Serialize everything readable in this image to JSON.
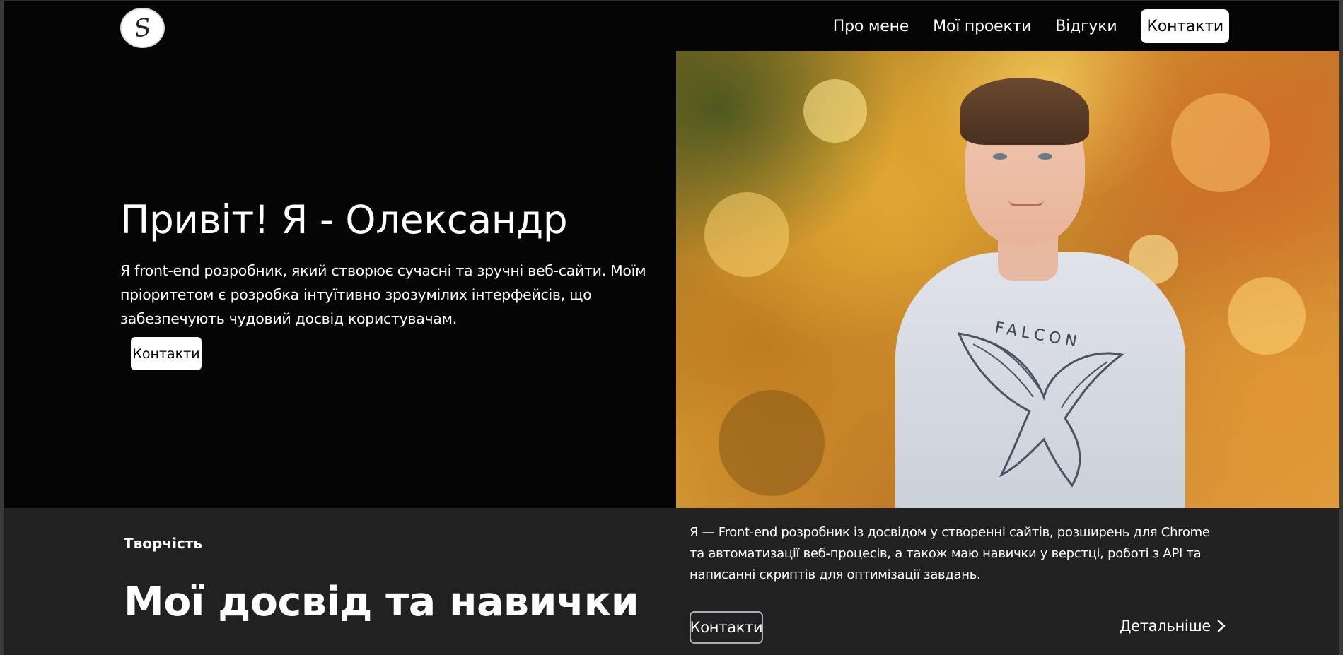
{
  "header": {
    "logo_icon": "signature-s-logo-icon",
    "logo_glyph": "S",
    "nav": [
      {
        "label": "Про мене"
      },
      {
        "label": "Мої проекти"
      },
      {
        "label": "Відгуки"
      },
      {
        "label": "Контакти"
      }
    ]
  },
  "hero": {
    "title": "Привіт! Я - Олександр",
    "text": "Я front-end розробник, який створює сучасні та зручні веб-сайти. Моїм пріоритетом є розробка інтуїтивно зрозумілих інтерфейсів, що забезпечують чудовий досвід користувачам.",
    "button_label": "Контакти",
    "photo_shirt_text": "FALCON"
  },
  "skills": {
    "eyebrow": "Творчість",
    "title": "Мої досвід та навички",
    "text": "Я — Front-end розробник із досвідом у створенні сайтів, розширень для Chrome та автоматизації веб-процесів, а також маю навички у верстці, роботі з API та написанні скриптів для оптимізації завдань.",
    "button_label": "Контакти",
    "more_label": "Детальніше",
    "more_icon": "chevron-right-icon"
  },
  "colors": {
    "hero_bg": "#050505",
    "section_bg": "#212121",
    "text": "#ffffff",
    "button_bg": "#ffffff"
  }
}
